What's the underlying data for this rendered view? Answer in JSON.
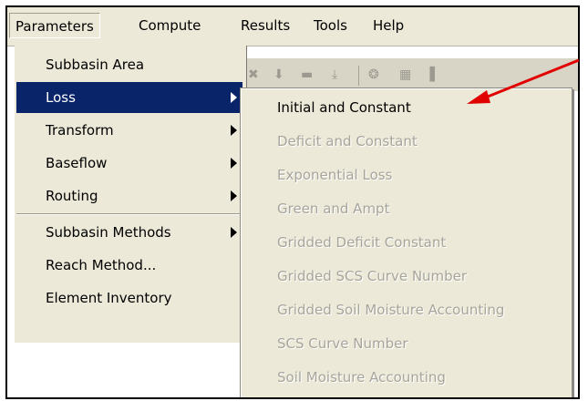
{
  "menubar": {
    "items": [
      "Parameters",
      "Compute",
      "Results",
      "Tools",
      "Help"
    ]
  },
  "parameters_menu": {
    "items": [
      {
        "label": "Subbasin Area",
        "submenu": false
      },
      {
        "label": "Loss",
        "submenu": true
      },
      {
        "label": "Transform",
        "submenu": true
      },
      {
        "label": "Baseflow",
        "submenu": true
      },
      {
        "label": "Routing",
        "submenu": true
      },
      {
        "label": "Subbasin Methods",
        "submenu": true
      },
      {
        "label": "Reach Method...",
        "submenu": false
      },
      {
        "label": "Element Inventory",
        "submenu": false
      }
    ],
    "selected": "Loss"
  },
  "loss_submenu": {
    "items": [
      {
        "label": "Initial and Constant",
        "enabled": true
      },
      {
        "label": "Deficit and Constant",
        "enabled": false
      },
      {
        "label": "Exponential Loss",
        "enabled": false
      },
      {
        "label": "Green and Ampt",
        "enabled": false
      },
      {
        "label": "Gridded Deficit Constant",
        "enabled": false
      },
      {
        "label": "Gridded SCS Curve Number",
        "enabled": false
      },
      {
        "label": "Gridded Soil Moisture Accounting",
        "enabled": false
      },
      {
        "label": "SCS Curve Number",
        "enabled": false
      },
      {
        "label": "Soil Moisture Accounting",
        "enabled": false
      }
    ]
  },
  "colors": {
    "menu_bg": "#ece9d8",
    "selection": "#0a246a",
    "disabled_text": "#a7a59b",
    "annotation_arrow": "#e00000"
  },
  "icons": [
    "toolbar-icon-1",
    "toolbar-icon-2",
    "toolbar-icon-3",
    "toolbar-icon-4",
    "toolbar-icon-5",
    "toolbar-icon-6",
    "toolbar-icon-7"
  ]
}
